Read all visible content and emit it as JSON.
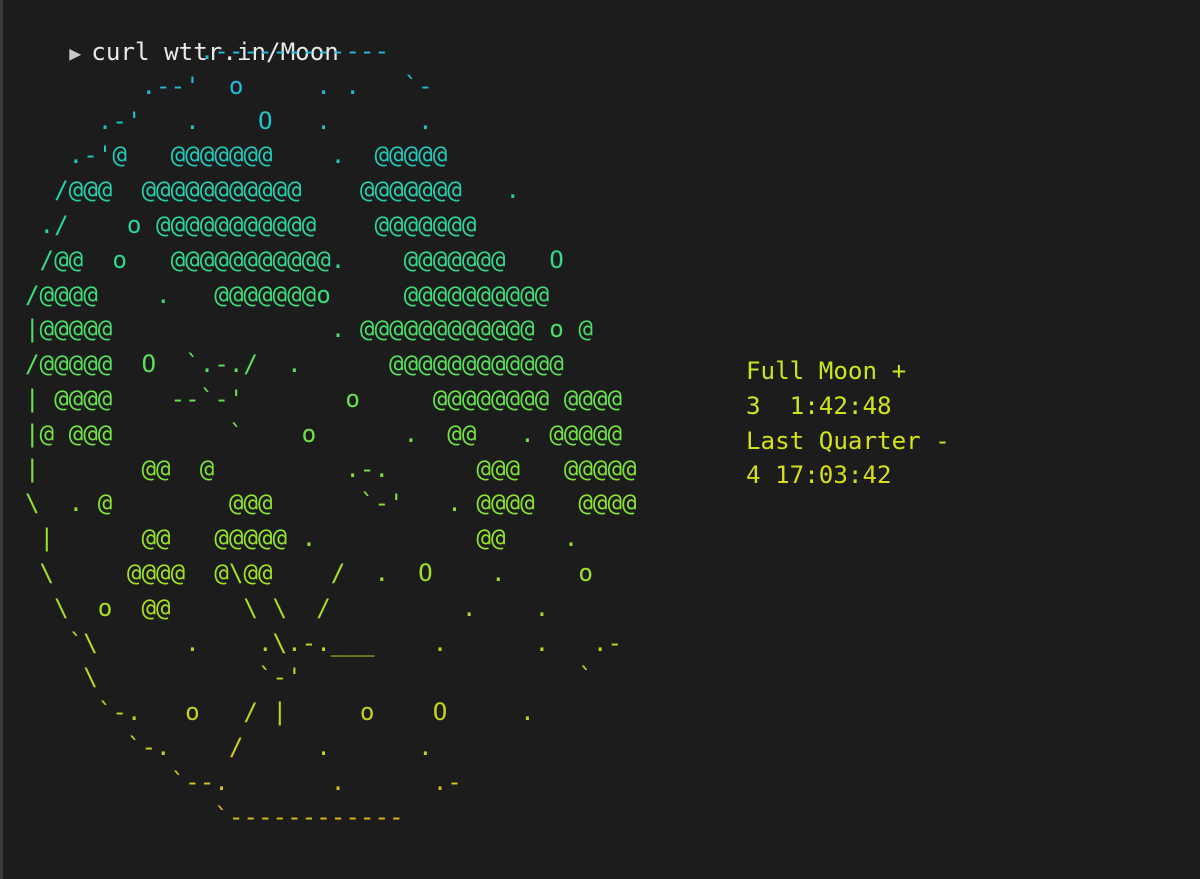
{
  "prompt": {
    "symbol": "▶",
    "command": "curl wttr.in/Moon"
  },
  "moon_art": {
    "lines": [
      "            .------------            ",
      "        .--'  o     . .   `-          ",
      "     .-'   .    O   .      .          ",
      "   .-'@   @@@@@@@    .  @@@@@        ",
      "  /@@@  @@@@@@@@@@@    @@@@@@@   .    ",
      " ./    o @@@@@@@@@@@    @@@@@@@       ",
      " /@@  o   @@@@@@@@@@@.    @@@@@@@   O ",
      "/@@@@    .   @@@@@@@o     @@@@@@@@@@  ",
      "|@@@@@               . @@@@@@@@@@@@ o @",
      "/@@@@@  O  `.-./  .      @@@@@@@@@@@@ ",
      "| @@@@    --`-'       o     @@@@@@@@ @@@@",
      "|@ @@@        `    o      .  @@   . @@@@@",
      "|       @@  @         .-.      @@@   @@@@@",
      "\\  . @        @@@      `-'   . @@@@   @@@@",
      " |      @@   @@@@@ .           @@    .",
      " \\     @@@@  @\\@@    /  .  O    .     o",
      "  \\  o  @@     \\ \\  /         .    .",
      "   `\\      .    .\\.-.___    .      .   .-",
      "    \\           `-'                   `",
      "     `-.   o   / |     o    O     .",
      "       `-.    /     .      .",
      "          `--.       .      .-",
      "             `------------"
    ],
    "colors": [
      "#1ebde0",
      "#1ebcd8",
      "#22c4c8",
      "#24c8b8",
      "#24cfaa",
      "#2ad49a",
      "#32d88a",
      "#3edc78",
      "#48de68",
      "#58e05a",
      "#66e24e",
      "#72e244",
      "#7ee23a",
      "#8ae232",
      "#94e22c",
      "#a0e026",
      "#aade22",
      "#b4dc1e",
      "#bcd81c",
      "#c4d41a",
      "#ccce1a",
      "#d6c41a",
      "#dcb81c"
    ]
  },
  "moon_info": {
    "lines": [
      "Full Moon +",
      "3  1:42:48",
      "Last Quarter -",
      "4 17:03:42"
    ],
    "colors": [
      "#c4e81a",
      "#cee61a",
      "#d4e21a",
      "#d8dc1a"
    ]
  }
}
